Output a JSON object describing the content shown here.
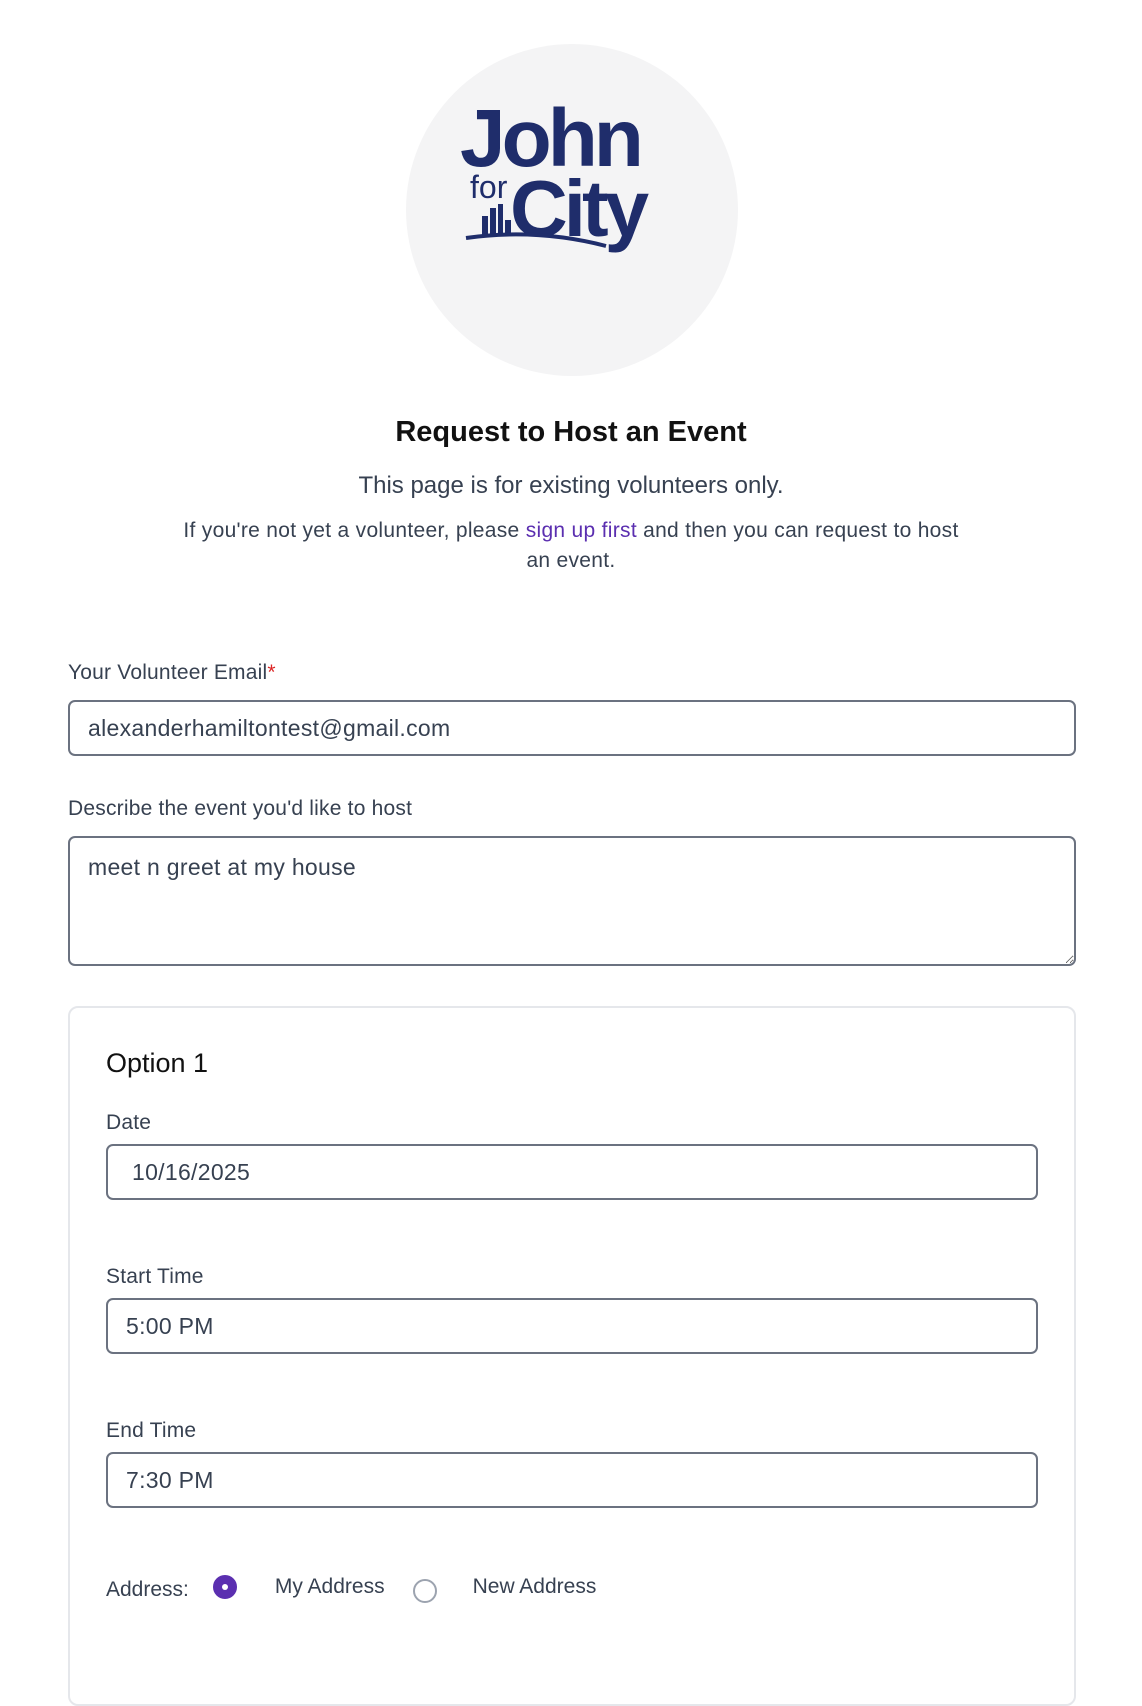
{
  "logo": {
    "line1": "John",
    "line2_small": "for",
    "line2_large": "City",
    "brand_color": "#1f2d6b"
  },
  "header": {
    "title": "Request to Host an Event",
    "subtitle": "This page is for existing volunteers only.",
    "intro_before": "If you're not yet a volunteer, please ",
    "intro_link": "sign up first",
    "intro_after": " and then you can request to host an event."
  },
  "form": {
    "email_label": "Your Volunteer Email",
    "email_required_mark": "*",
    "email_value": "alexanderhamiltontest@gmail.com",
    "describe_label": "Describe the event you'd like to host",
    "describe_value": "meet n greet at my house",
    "option": {
      "title": "Option 1",
      "date_label": "Date",
      "date_value": "10/16/2025",
      "start_label": "Start Time",
      "start_value": "5:00 PM",
      "end_label": "End Time",
      "end_value": "7:30 PM",
      "address_label": "Address:",
      "address_options": [
        "My Address",
        "New Address"
      ],
      "address_selected": "My Address"
    }
  },
  "colors": {
    "accent": "#5b2fb0",
    "required": "#dc2626",
    "border": "#6b7280"
  }
}
